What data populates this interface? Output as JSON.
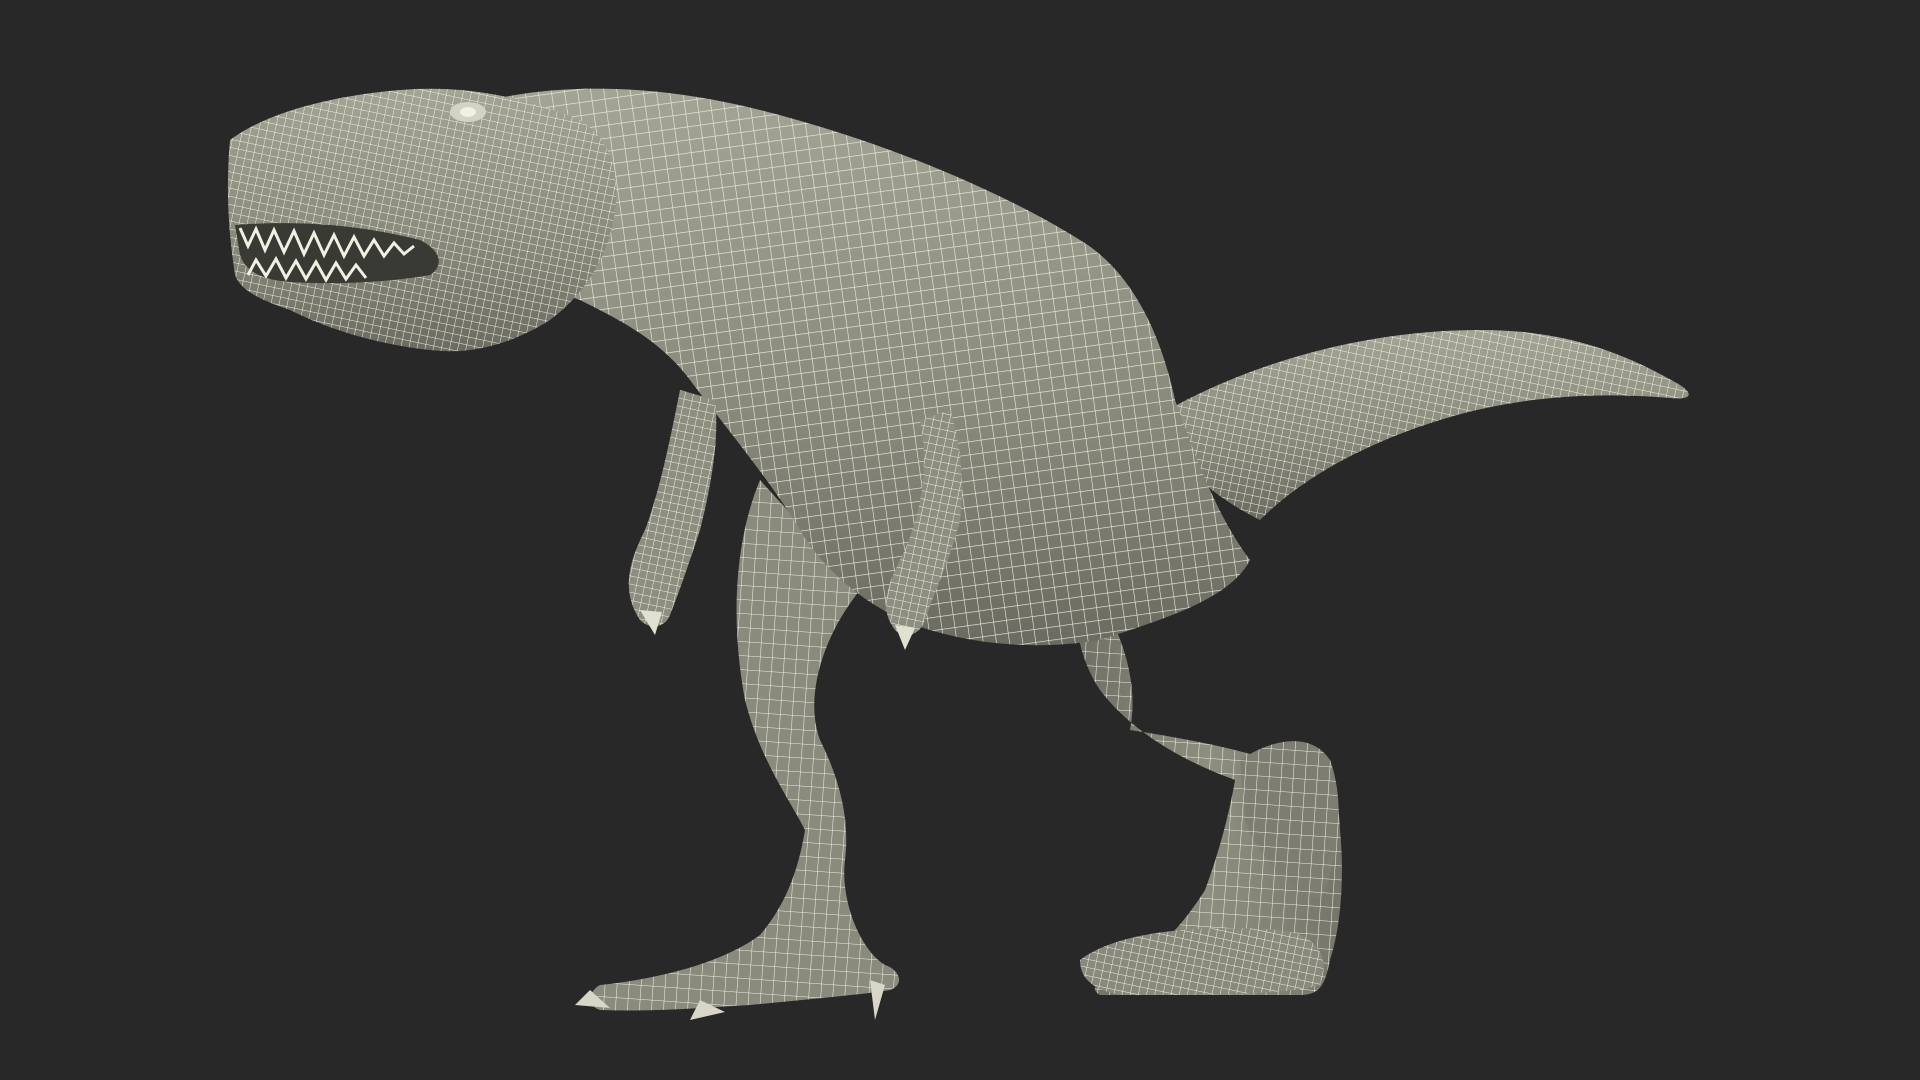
{
  "scene": {
    "subject": "tyrannosaurus-rex-wireframe",
    "render_mode": "wireframe",
    "colors": {
      "background": "#282828",
      "surface": "#8b8b7d",
      "surface_shadow": "#6b6b61",
      "surface_light": "#a4a495",
      "wire": "#efeddd",
      "mouth_dark": "#3a3a35",
      "teeth": "#f2f0e2"
    }
  }
}
